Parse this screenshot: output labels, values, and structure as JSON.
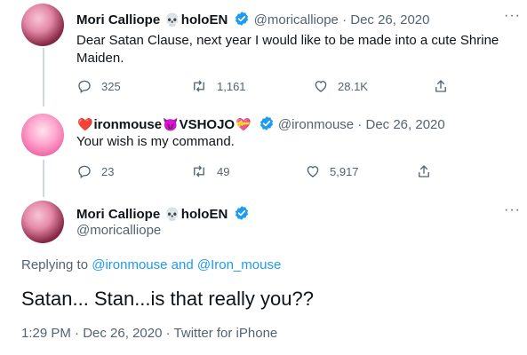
{
  "tweet1": {
    "display_name": "Mori Calliope",
    "name_suffix": "holoEN",
    "emoji_skull": "💀",
    "handle": "@moricalliope",
    "separator": "·",
    "date": "Dec 26, 2020",
    "text": "Dear Satan Clause, next year I would like to be made into a cute Shrine Maiden.",
    "replies": "325",
    "retweets": "1,161",
    "likes": "28.1K"
  },
  "tweet2": {
    "emoji_heart": "❤️",
    "display_name": "ironmouse",
    "emoji_devil": "😈",
    "name_suffix": "VSHOJO",
    "emoji_heart2": "💝",
    "handle": "@ironmouse",
    "separator": "·",
    "date": "Dec 26, 2020",
    "text": "Your wish is my command.",
    "replies": "23",
    "retweets": "49",
    "likes": "5,917"
  },
  "main_tweet": {
    "display_name": "Mori Calliope",
    "emoji_skull": "💀",
    "name_suffix": "holoEN",
    "handle": "@moricalliope",
    "replying_prefix": "Replying to",
    "reply_mention_1": "@ironmouse",
    "reply_and": "and",
    "reply_mention_2": "@Iron_mouse",
    "text": "Satan... Stan...is that really you??",
    "time": "1:29 PM",
    "separator": "·",
    "date": "Dec 26, 2020",
    "source": "Twitter for iPhone"
  },
  "more_glyph": "···",
  "colors": {
    "verified": "#1d9bf0",
    "link": "#1d9bf0",
    "muted": "#536471",
    "text": "#0f1419"
  }
}
